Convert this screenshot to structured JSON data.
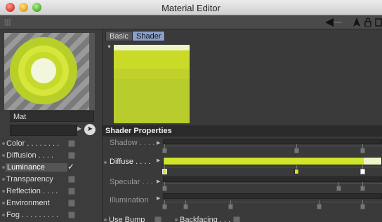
{
  "window": {
    "title": "Material Editor"
  },
  "toolbar": {
    "icons": [
      "grip-icon",
      "back-arrow-icon",
      "cursor-icon",
      "lock-icon",
      "copy-icon"
    ]
  },
  "preview": {
    "material_name": "Mat"
  },
  "channels": [
    {
      "label": "Color . . . . . . . .",
      "enabled": false
    },
    {
      "label": "Diffusion . . . .",
      "enabled": false
    },
    {
      "label": "Luminance",
      "enabled": true
    },
    {
      "label": "Transparency",
      "enabled": false
    },
    {
      "label": "Reflection . . . .",
      "enabled": false
    },
    {
      "label": "Environment",
      "enabled": false
    },
    {
      "label": "Fog . . . . . . . . .",
      "enabled": false
    }
  ],
  "tabs": [
    {
      "label": "Basic"
    },
    {
      "label": "Shader"
    }
  ],
  "shader_properties": {
    "header": "Shader Properties",
    "shadow_label": "Shadow . . . .",
    "diffuse_label": "Diffuse . . . .",
    "specular_label": "Specular . . .",
    "illumination_label": "Illumination",
    "use_bump_label": "Use Bump",
    "backfacing_label": "Backfacing . . . ."
  },
  "colors": {
    "diffuse_gradient": "#d2e62a",
    "swatch_light": "#eef5c8",
    "swatch_mid": "#c9da28",
    "accent": "#8aa0c8"
  }
}
